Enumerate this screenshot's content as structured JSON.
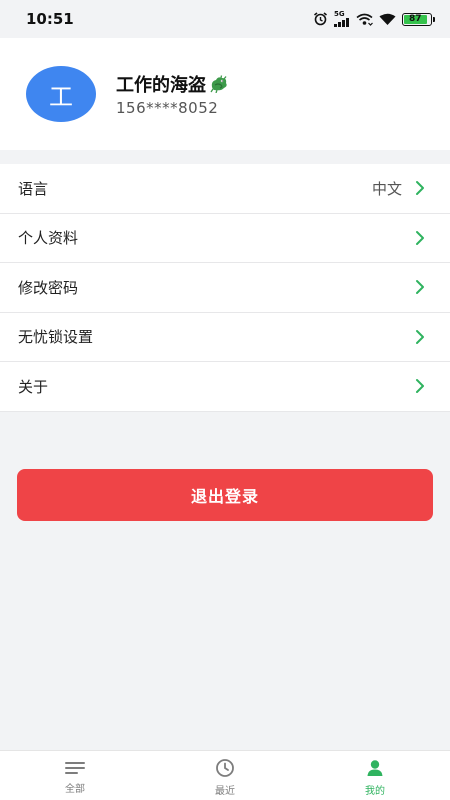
{
  "status_bar": {
    "time": "10:51",
    "network_label": "5G",
    "battery_level": "87",
    "icons": [
      "alarm-icon",
      "cellular-signal-icon",
      "hotspot-icon",
      "wifi-icon",
      "battery-icon"
    ]
  },
  "profile": {
    "avatar_letter": "工",
    "name": "工作的海盗",
    "phone": "156****8052",
    "avatar_color": "#3f86f0",
    "name_icon": "dragon-emoji-icon"
  },
  "menu": {
    "items": [
      {
        "label": "语言",
        "value": "中文"
      },
      {
        "label": "个人资料"
      },
      {
        "label": "修改密码"
      },
      {
        "label": "无忧锁设置"
      },
      {
        "label": "关于"
      }
    ],
    "chevron_color": "#2fb35f"
  },
  "logout": {
    "label": "退出登录",
    "color": "#ef4447"
  },
  "bottom_nav": {
    "items": [
      {
        "label": "全部",
        "icon": "list-icon"
      },
      {
        "label": "最近",
        "icon": "clock-icon"
      },
      {
        "label": "我的",
        "icon": "person-icon",
        "active": true
      }
    ],
    "active_color": "#2fb35f"
  }
}
